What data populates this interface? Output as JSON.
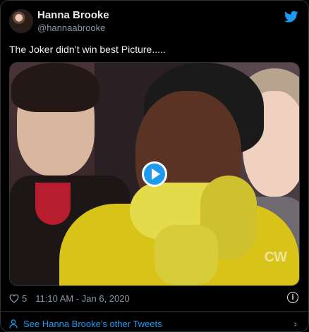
{
  "author": {
    "display_name": "Hanna Brooke",
    "handle": "@hannaabrooke"
  },
  "tweet": {
    "text": "The Joker didn’t win best Picture....."
  },
  "media": {
    "watermark": "CW",
    "type": "video"
  },
  "meta": {
    "like_count": "5",
    "timestamp": "11:10 AM - Jan 6, 2020"
  },
  "footer": {
    "see_more_label": "See Hanna Brooke's other Tweets"
  },
  "icons": {
    "brand": "twitter-bird-icon",
    "like": "heart-icon",
    "info": "info-icon",
    "see_more": "person-icon",
    "chevron": "chevron-right-icon",
    "play": "play-icon"
  },
  "colors": {
    "background": "#000000",
    "accent": "#1d9bf0",
    "muted_text": "#8b98a5",
    "border": "#2f3336"
  }
}
